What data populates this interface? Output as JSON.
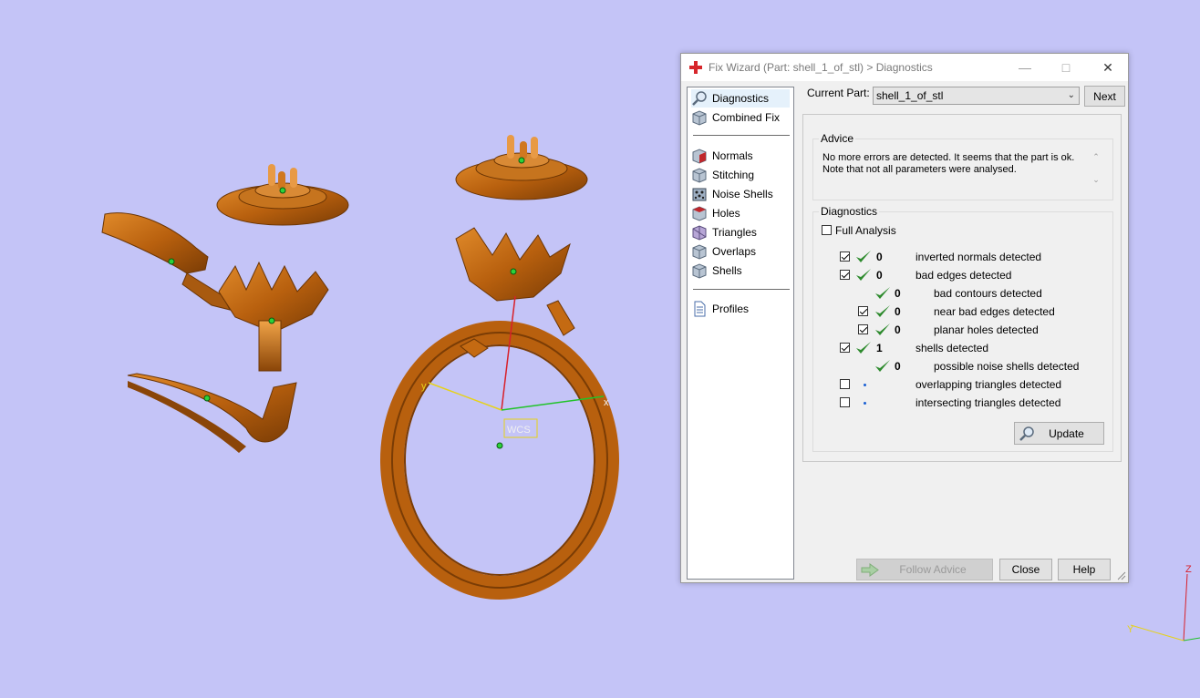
{
  "viewport": {
    "wcs_label": "WCS",
    "axis_x": "x",
    "axis_y": "y",
    "triad_z": "Z",
    "triad_y": "Y"
  },
  "dialog": {
    "title": "Fix Wizard (Part: shell_1_of_stl) > Diagnostics",
    "nav": {
      "top_items": [
        {
          "label": "Diagnostics",
          "icon": "magnifier-icon"
        },
        {
          "label": "Combined Fix",
          "icon": "cube-icon"
        }
      ],
      "fix_items": [
        {
          "label": "Normals",
          "icon": "normals-cube-icon"
        },
        {
          "label": "Stitching",
          "icon": "stitching-cube-icon"
        },
        {
          "label": "Noise Shells",
          "icon": "noise-shells-icon"
        },
        {
          "label": "Holes",
          "icon": "holes-cube-icon"
        },
        {
          "label": "Triangles",
          "icon": "triangles-cube-icon"
        },
        {
          "label": "Overlaps",
          "icon": "overlaps-cube-icon"
        },
        {
          "label": "Shells",
          "icon": "shells-cube-icon"
        }
      ],
      "profiles": {
        "label": "Profiles",
        "icon": "document-icon"
      }
    },
    "current_part_label": "Current Part:",
    "current_part_value": "shell_1_of_stl",
    "next_label": "Next",
    "advice": {
      "title": "Advice",
      "line1": "No more errors are detected. It seems that the part is ok.",
      "line2": "Note that not all parameters were analysed."
    },
    "diagnostics": {
      "title": "Diagnostics",
      "full_analysis": "Full Analysis",
      "rows": [
        {
          "checked": true,
          "status": "ok",
          "count": "0",
          "label": "inverted normals detected"
        },
        {
          "checked": true,
          "status": "ok",
          "count": "0",
          "label": "bad edges detected"
        },
        {
          "checked": null,
          "status": "ok",
          "count": "0",
          "label": "bad contours detected"
        },
        {
          "checked": true,
          "status": "ok",
          "count": "0",
          "label": "near bad edges detected"
        },
        {
          "checked": true,
          "status": "ok",
          "count": "0",
          "label": "planar holes detected"
        },
        {
          "checked": true,
          "status": "ok",
          "count": "1",
          "label": "shells detected"
        },
        {
          "checked": null,
          "status": "ok",
          "count": "0",
          "label": "possible noise shells detected"
        },
        {
          "checked": false,
          "status": "pending",
          "count": "",
          "label": "overlapping triangles detected"
        },
        {
          "checked": false,
          "status": "pending",
          "count": "",
          "label": "intersecting triangles detected"
        }
      ],
      "update_label": "Update"
    },
    "buttons": {
      "follow_advice": "Follow Advice",
      "close": "Close",
      "help": "Help"
    },
    "colors": {
      "accent_check": "#2e8b2e",
      "model": "#c46a12",
      "background": "#c4c4f7"
    }
  }
}
